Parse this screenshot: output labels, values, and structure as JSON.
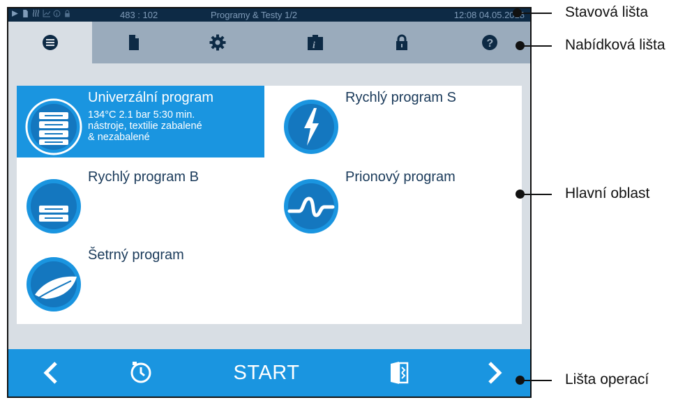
{
  "status_bar": {
    "counter": "483 : 102",
    "title": "Programy & Testy 1/2",
    "time": "12:08",
    "date": "04.05.2018",
    "icons": [
      "play-icon",
      "document-icon",
      "heating-icon",
      "chart-icon",
      "info-icon",
      "lock-icon"
    ]
  },
  "menu_bar": {
    "tabs": [
      {
        "icon": "list-icon",
        "active": true
      },
      {
        "icon": "document-icon",
        "active": false
      },
      {
        "icon": "gear-icon",
        "active": false
      },
      {
        "icon": "info-folder-icon",
        "active": false
      },
      {
        "icon": "lock-icon",
        "active": false
      },
      {
        "icon": "help-icon",
        "active": false
      }
    ]
  },
  "programs": [
    {
      "name": "Univerzální program",
      "selected": true,
      "icon": "trays-icon",
      "desc_line1": "134°C 2.1 bar 5:30 min.",
      "desc_line2": "nástroje, textilie zabalené",
      "desc_line3": "& nezabalené"
    },
    {
      "name": "Rychlý program S",
      "selected": false,
      "icon": "lightning-icon"
    },
    {
      "name": "Rychlý program B",
      "selected": false,
      "icon": "tray-icon"
    },
    {
      "name": "Prionový program",
      "selected": false,
      "icon": "prion-icon"
    },
    {
      "name": "Šetrný program",
      "selected": false,
      "icon": "feather-icon"
    }
  ],
  "operation_bar": {
    "start_label": "START",
    "icons": [
      "back-arrow-icon",
      "timer-icon",
      "door-icon",
      "forward-arrow-icon"
    ]
  },
  "callouts": {
    "status_bar": "Stavová lišta",
    "menu_bar": "Nabídková lišta",
    "main_area": "Hlavní oblast",
    "operation_bar": "Lišta operací"
  },
  "colors": {
    "accent": "#1a95e0",
    "status_bg": "#0d2a45",
    "menu_bg": "#9aabbc",
    "screen_bg": "#d8dee4"
  }
}
